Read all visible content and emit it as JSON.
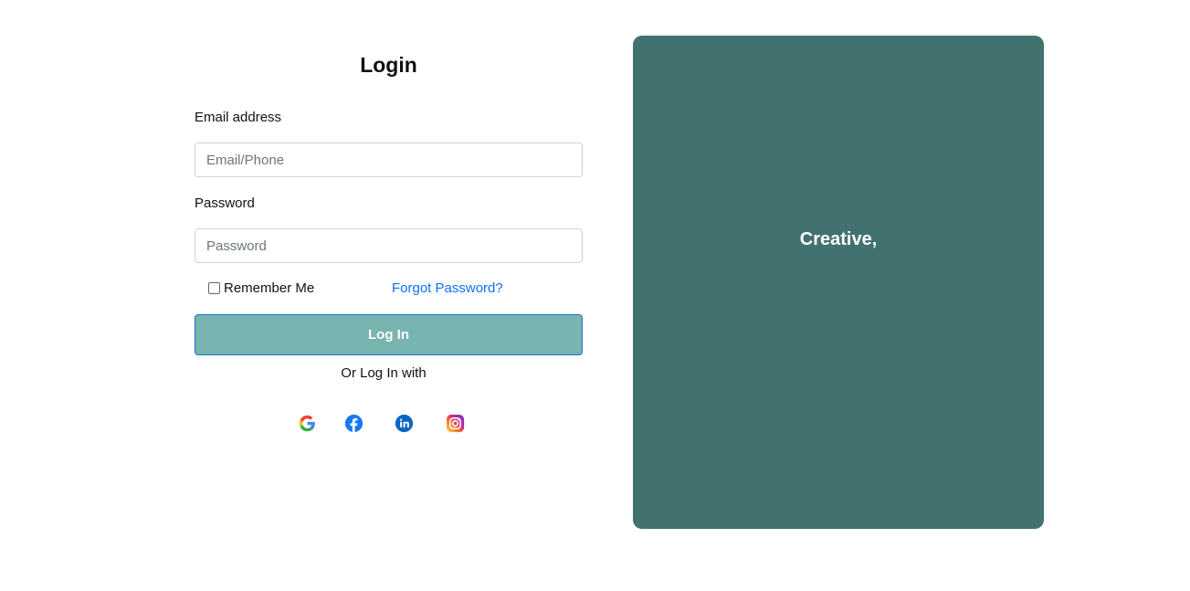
{
  "login": {
    "title": "Login",
    "email_label": "Email address",
    "email_placeholder": "Email/Phone",
    "email_value": "",
    "password_label": "Password",
    "password_placeholder": "Password",
    "password_value": "",
    "remember_label": "Remember Me",
    "remember_checked": false,
    "forgot_label": "Forgot Password?",
    "button_label": "Log In",
    "or_text": "Or Log In with",
    "social": [
      "google-icon",
      "facebook-icon",
      "linkedin-icon",
      "instagram-icon"
    ]
  },
  "hero": {
    "text": "Creative,",
    "background": "#41726f"
  },
  "colors": {
    "button_bg": "#78b4b0",
    "link": "#0d6efd"
  }
}
